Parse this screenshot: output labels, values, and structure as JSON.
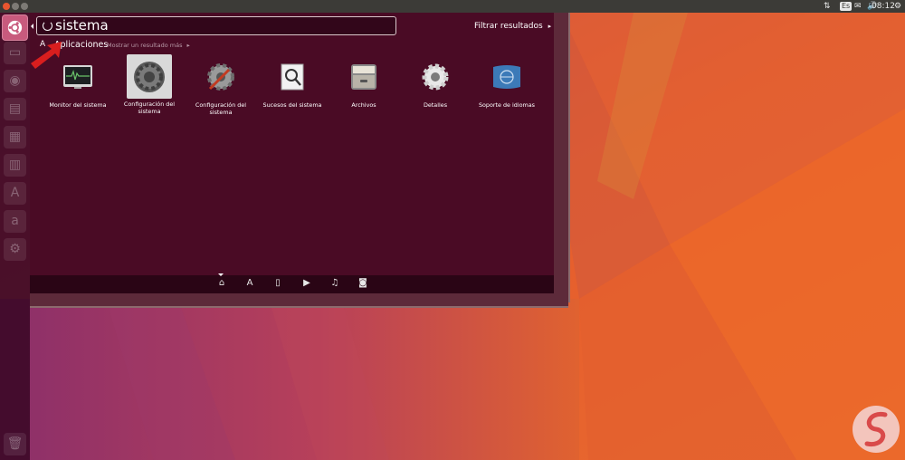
{
  "top_panel": {
    "keyboard_indicator": "Es",
    "clock": "08:12",
    "icons": [
      "network-icon",
      "keyboard-icon",
      "mail-icon",
      "volume-icon",
      "gear-icon"
    ]
  },
  "dash": {
    "search": {
      "value": "sistema"
    },
    "filter_label": "Filtrar resultados",
    "category": {
      "title": "Aplicaciones",
      "more_label": "Mostrar un resultado más"
    },
    "apps": [
      {
        "label": "Monitor del sistema",
        "icon": "system-monitor-icon"
      },
      {
        "label": "Configuración del sistema",
        "icon": "system-settings-icon",
        "selected": true
      },
      {
        "label": "Configuración del sistema",
        "icon": "system-settings-tools-icon"
      },
      {
        "label": "Sucesos del sistema",
        "icon": "system-log-icon"
      },
      {
        "label": "Archivos",
        "icon": "files-icon"
      },
      {
        "label": "Detalles",
        "icon": "details-gear-icon"
      },
      {
        "label": "Soporte de idiomas",
        "icon": "language-support-icon"
      }
    ],
    "lenses": [
      "home-icon",
      "applications-icon",
      "files-icon",
      "video-icon",
      "music-icon",
      "photos-icon"
    ]
  },
  "launcher": {
    "items": [
      "ubuntu-dash-icon",
      "files-icon",
      "firefox-icon",
      "writer-icon",
      "calc-icon",
      "impress-icon",
      "software-center-icon",
      "amazon-icon",
      "settings-icon",
      "trash-icon"
    ]
  },
  "colors": {
    "dash_bg": "#4a0b25",
    "accent": "#c85a7d",
    "wallpaper_orange": "#e05a2b"
  }
}
